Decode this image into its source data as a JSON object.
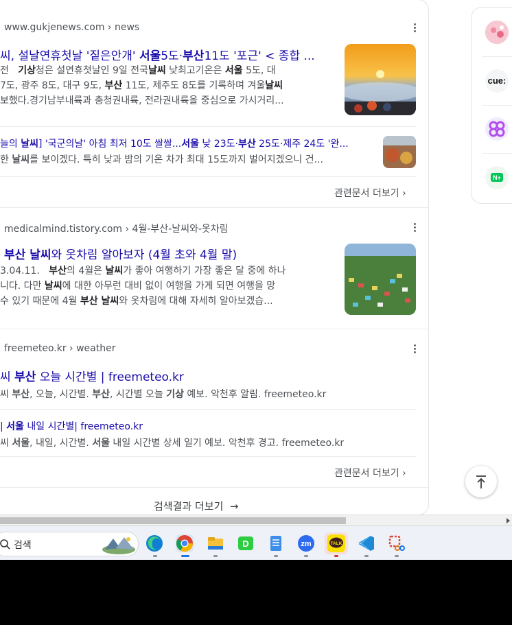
{
  "results": [
    {
      "source": "www.gukjenews.com › news",
      "title_html": "씨, 설날연휴첫날 '짙은안개' <b>서울</b>5도·<b>부산</b>11도 '포근' < 종합 ...",
      "snippet_lines": [
        "전 &nbsp;&nbsp;<b>기상</b>청은 설연휴첫날인 9일 전국<b>날씨</b> 낮최고기온은 <b>서울</b> 5도, 대",
        "7도, 광주 8도, 대구 9도, <b>부산</b> 11도, 제주도 8도를 기록하며 겨울<b>날씨</b>",
        "보했다.경기남부내륙과 충청권내륙, 전라권내륙을 중심으로 가시거리..."
      ],
      "sub": {
        "title_html": "늘의 <b>날씨</b>] '국군의날' 아침 최저 10도 쌀쌀...<b>서울</b> 낮 23도·<b>부산</b> 25도·제주 24도 '완...",
        "snippet_html": "한 <b>날씨</b>를 보이겠다. 특히 낮과 밤의 기온 차가 최대 15도까지 벌어지겠으니 건..."
      },
      "more_label": "관련문서 더보기"
    },
    {
      "source": "medicalmind.tistory.com › 4월-부산-날씨와-옷차림",
      "title_html": "<b>부산 날씨</b>와 옷차림 알아보자 (4월 초와 4월 말)",
      "snippet_lines": [
        "3.04.11. &nbsp;&nbsp;<b>부산</b>의 4월은 <b>날씨</b>가 좋아 여행하기 가장 좋은 달 중에 하나",
        "니다. 다만 <b>날씨</b>에 대한 아무런 대비 없이 여행을 가게 되면 여행을 망",
        "수 있기 때문에 4월 <b>부산 날씨</b>와 옷차림에 대해 자세히 알아보겠습..."
      ]
    },
    {
      "source": "freemeteo.kr › weather",
      "title_html": "씨 <b>부산</b> 오늘 시간별 | freemeteo.kr",
      "snippet_html": "씨 <b>부산</b>, 오늘, 시간별. <b>부산</b>, 시간별 오늘 <b>기상</b> 예보. 악천후 알림. freemeteo.kr",
      "sub": {
        "title_html": "| <b>서울</b> 내일 시간별| freemeteo.kr",
        "snippet_html": "씨 <b>서울</b>, 내일, 시간별. <b>서울</b> 내일 시간별 상세 일기 예보. 악천후 경고. freemeteo.kr"
      },
      "more_label": "관련문서 더보기"
    }
  ],
  "more_results_label": "검색결과 더보기",
  "more_results_arrow": "→",
  "more_chevron": "›",
  "sidebar_icons": [
    {
      "name": "profile-avatar-icon"
    },
    {
      "name": "cue-icon",
      "text": "cue:"
    },
    {
      "name": "butterfly-app-icon"
    },
    {
      "name": "naver-plus-icon",
      "text": "N+"
    }
  ],
  "taskbar": {
    "search_placeholder": "검색",
    "apps": [
      "edge-icon",
      "chrome-icon",
      "file-explorer-icon",
      "d-app-icon",
      "notepad-icon",
      "zoom-icon",
      "kakaotalk-icon",
      "vscode-icon",
      "snipping-tool-icon"
    ],
    "zoom_text": "zm",
    "kakao_text": "TALK",
    "d_text": "D"
  },
  "colors": {
    "link": "#1a0dab",
    "snippet": "#4d5156",
    "accent": "#1a73e8"
  }
}
